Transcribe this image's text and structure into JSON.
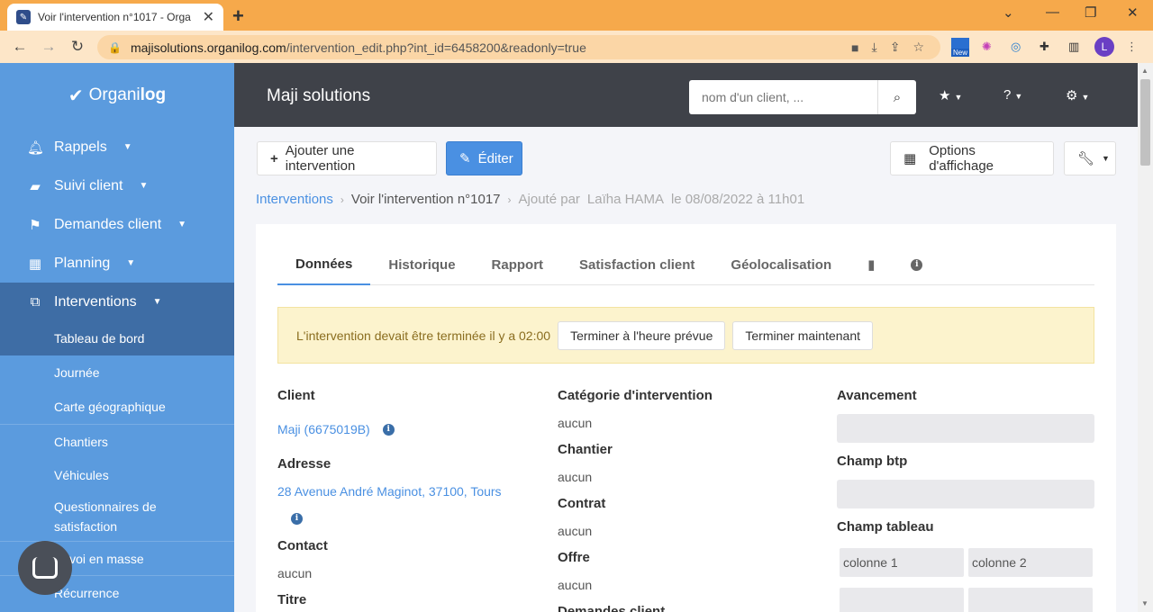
{
  "browser": {
    "tab_title": "Voir l'intervention n°1017 - Orga",
    "url_host": "majisolutions.organilog.com",
    "url_path": "/intervention_edit.php?int_id=6458200&readonly=true",
    "ext_new_badge": "New",
    "profile_initial": "L"
  },
  "sidebar": {
    "logo_text": "Organi",
    "logo_bold": "log",
    "items": [
      {
        "label": "Rappels",
        "icon": "bell-icon"
      },
      {
        "label": "Suivi client",
        "icon": "folder-icon"
      },
      {
        "label": "Demandes client",
        "icon": "flag-icon"
      },
      {
        "label": "Planning",
        "icon": "calendar-icon"
      },
      {
        "label": "Interventions",
        "icon": "interventions-icon"
      }
    ],
    "sub_items": [
      "Tableau de bord",
      "Journée",
      "Carte géographique",
      "Chantiers",
      "Véhicules",
      "Questionnaires de satisfaction",
      "Envoi en masse",
      "Récurrence"
    ]
  },
  "topbar": {
    "brand": "Maji solutions",
    "search_placeholder": "nom d'un client, ..."
  },
  "toolbar": {
    "add_label": "Ajouter une intervention",
    "edit_label": "Éditer",
    "display_options_label": "Options d'affichage"
  },
  "breadcrumb": {
    "root": "Interventions",
    "current": "Voir l'intervention n°1017",
    "added_by_prefix": "Ajouté par",
    "added_by_name": "Laïha HAMA",
    "added_on": "le 08/08/2022 à 11h01"
  },
  "tabs": [
    "Données",
    "Historique",
    "Rapport",
    "Satisfaction client",
    "Géolocalisation"
  ],
  "alert": {
    "message": "L'intervention devait être terminée il y a 02:00",
    "finish_planned_label": "Terminer à l'heure prévue",
    "finish_now_label": "Terminer maintenant"
  },
  "details": {
    "client_label": "Client",
    "client_value": "Maji (6675019B)",
    "address_label": "Adresse",
    "address_value": "28 Avenue André Maginot, 37100, Tours",
    "contact_label": "Contact",
    "contact_value": "aucun",
    "title_label": "Titre",
    "category_label": "Catégorie d'intervention",
    "category_value": "aucun",
    "site_label": "Chantier",
    "site_value": "aucun",
    "contract_label": "Contrat",
    "contract_value": "aucun",
    "offer_label": "Offre",
    "offer_value": "aucun",
    "requests_label": "Demandes client",
    "progress_label": "Avancement",
    "btp_label": "Champ btp",
    "table_label": "Champ tableau",
    "col1": "colonne 1",
    "col2": "colonne 2"
  }
}
